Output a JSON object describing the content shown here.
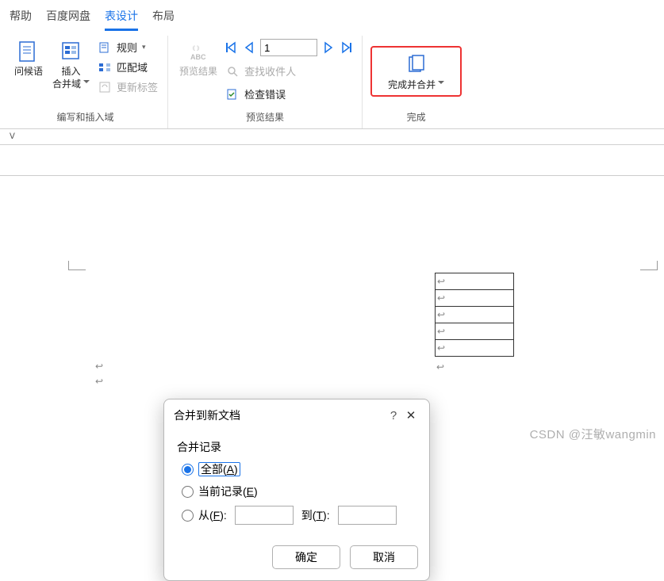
{
  "tabs": {
    "help": "帮助",
    "baidu": "百度网盘",
    "table_design": "表设计",
    "layout": "布局"
  },
  "ribbon": {
    "group1": {
      "greeting": "问候语",
      "insert_merge_field": "插入\n合并域",
      "rules": "规则",
      "match_fields": "匹配域",
      "update_labels": "更新标签",
      "label": "编写和插入域"
    },
    "group2": {
      "preview": "预览结果",
      "find_recipient": "查找收件人",
      "check_errors": "检查错误",
      "label": "预览结果",
      "record_value": "1"
    },
    "group3": {
      "finish": "完成并合并",
      "label": "完成"
    }
  },
  "dialog": {
    "title": "合并到新文档",
    "section": "合并记录",
    "opt_all_prefix": "全部(",
    "opt_all_key": "A",
    "opt_all_suffix": ")",
    "opt_current_prefix": "当前记录(",
    "opt_current_key": "E",
    "opt_current_suffix": ")",
    "opt_from_prefix": "从(",
    "opt_from_key": "F",
    "opt_from_suffix": "):",
    "to_prefix": "到(",
    "to_key": "T",
    "to_suffix": "):",
    "ok": "确定",
    "cancel": "取消"
  },
  "watermark": "CSDN @汪敏wangmin"
}
